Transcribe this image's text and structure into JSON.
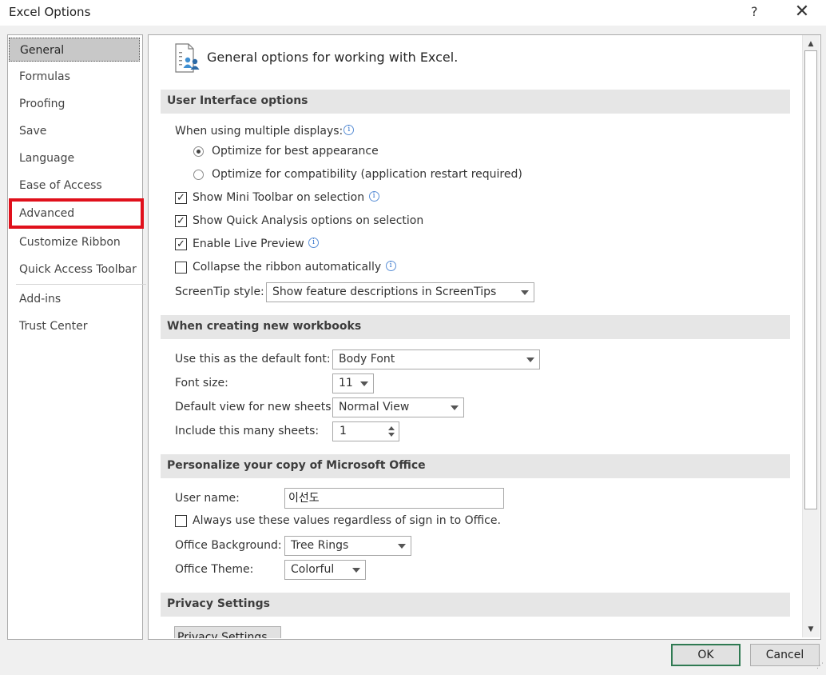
{
  "window": {
    "title": "Excel Options",
    "help": "?",
    "close": "✕"
  },
  "sidebar": {
    "items": [
      {
        "label": "General"
      },
      {
        "label": "Formulas"
      },
      {
        "label": "Proofing"
      },
      {
        "label": "Save"
      },
      {
        "label": "Language"
      },
      {
        "label": "Ease of Access"
      },
      {
        "label": "Advanced"
      },
      {
        "label": "Customize Ribbon"
      },
      {
        "label": "Quick Access Toolbar"
      },
      {
        "label": "Add-ins"
      },
      {
        "label": "Trust Center"
      }
    ],
    "selected": "General",
    "highlighted": "Advanced",
    "highlight_color": "#e0101b"
  },
  "header": {
    "icon": "general-options-icon",
    "text": "General options for working with Excel."
  },
  "ui_options": {
    "heading": "User Interface options",
    "multiple_displays_label": "When using multiple displays:",
    "radio_best": "Optimize for best appearance",
    "radio_compat": "Optimize for compatibility (application restart required)",
    "radio_selected": "best",
    "mini_toolbar": {
      "label": "Show Mini Toolbar on selection",
      "checked": true
    },
    "quick_analysis": {
      "label": "Show Quick Analysis options on selection",
      "checked": true
    },
    "live_preview": {
      "label": "Enable Live Preview",
      "checked": true
    },
    "collapse_ribbon": {
      "label": "Collapse the ribbon automatically",
      "checked": false
    },
    "screentip_label": "ScreenTip style:",
    "screentip_value": "Show feature descriptions in ScreenTips"
  },
  "new_workbooks": {
    "heading": "When creating new workbooks",
    "font_label": "Use this as the default font:",
    "font_value": "Body Font",
    "size_label": "Font size:",
    "size_value": "11",
    "view_label": "Default view for new sheets:",
    "view_value": "Normal View",
    "sheets_label": "Include this many sheets:",
    "sheets_value": "1"
  },
  "personalize": {
    "heading": "Personalize your copy of Microsoft Office",
    "username_label": "User name:",
    "username_value": "이선도",
    "always_use": {
      "label": "Always use these values regardless of sign in to Office.",
      "checked": false
    },
    "background_label": "Office Background:",
    "background_value": "Tree Rings",
    "theme_label": "Office Theme:",
    "theme_value": "Colorful"
  },
  "privacy": {
    "heading": "Privacy Settings",
    "button": "Privacy Settings..."
  },
  "footer": {
    "ok": "OK",
    "cancel": "Cancel"
  },
  "info_glyph": "i",
  "check_glyph": "✓"
}
